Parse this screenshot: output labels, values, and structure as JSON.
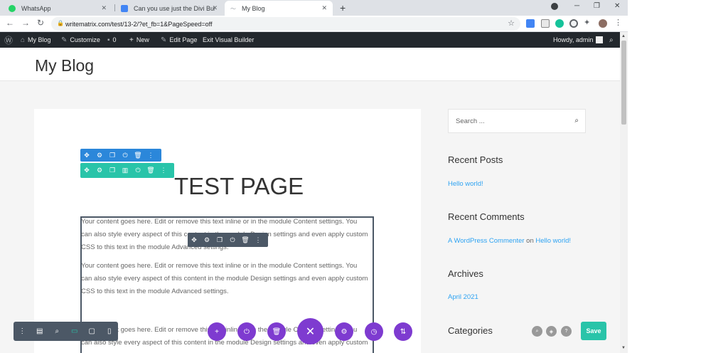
{
  "browser": {
    "tabs": [
      {
        "title": "WhatsApp",
        "favicon_color": "#25d366"
      },
      {
        "title": "Can you use just the Divi Builder",
        "favicon_color": "#4285f4"
      },
      {
        "title": "My Blog",
        "favicon_color": "#9aa0a6"
      }
    ],
    "new_tab": "+",
    "url": "writematrix.com/test/13-2/?et_fb=1&PageSpeed=off"
  },
  "adminbar": {
    "my_blog": "My Blog",
    "customize": "Customize",
    "comments_count": "0",
    "new": "New",
    "edit_page": "Edit Page",
    "exit_builder": "Exit Visual Builder",
    "howdy": "Howdy, admin"
  },
  "site": {
    "title": "My Blog"
  },
  "content": {
    "heading": "TEST PAGE",
    "paragraphs": [
      [
        "Your content goes here. Edit or remove this text inline or in the module Content settings. You",
        "can also style every aspect of this content in the module Design settings and even apply custom",
        "CSS to this text in the module Advanced settings."
      ],
      [
        "Your content goes here. Edit or remove this text inline or in the module Content settings. You",
        "can also style every aspect of this content in the module Design settings and even apply custom",
        "CSS to this text in the module Advanced settings."
      ],
      [
        "Your content goes here. Edit or remove this text inline or in the module Content settings. You",
        "can also style every aspect of this content in the module Design settings and even apply custom"
      ]
    ]
  },
  "sidebar": {
    "search_placeholder": "Search ...",
    "recent_posts_title": "Recent Posts",
    "recent_post": "Hello world!",
    "recent_comments_title": "Recent Comments",
    "comment_author": "A WordPress Commenter",
    "comment_on": "on",
    "comment_post": "Hello world!",
    "archives_title": "Archives",
    "archive_month": "April 2021",
    "categories_title": "Categories"
  },
  "builder": {
    "save_label": "Save",
    "colors": {
      "section": "#2b87da",
      "row": "#29c4a9",
      "module": "#4c5866",
      "purple": "#7e3bd0",
      "save": "#29c4a9"
    }
  }
}
